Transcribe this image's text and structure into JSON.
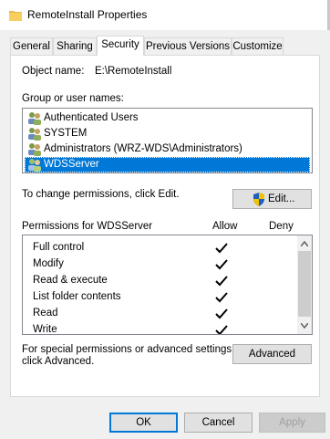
{
  "window": {
    "title": "RemoteInstall Properties"
  },
  "tabs": [
    {
      "label": "General"
    },
    {
      "label": "Sharing"
    },
    {
      "label": "Security"
    },
    {
      "label": "Previous Versions"
    },
    {
      "label": "Customize"
    }
  ],
  "object": {
    "label": "Object name:",
    "value": "E:\\RemoteInstall"
  },
  "groups": {
    "label": "Group or user names:",
    "items": [
      {
        "label": "Authenticated Users"
      },
      {
        "label": "SYSTEM"
      },
      {
        "label": "Administrators (WRZ-WDS\\Administrators)"
      },
      {
        "label": "WDSServer"
      }
    ]
  },
  "change_perm_text": "To change permissions, click Edit.",
  "edit_button": "Edit...",
  "permissions": {
    "header": "Permissions for WDSServer",
    "allow_label": "Allow",
    "deny_label": "Deny",
    "rows": [
      {
        "label": "Full control",
        "allow": true,
        "deny": false
      },
      {
        "label": "Modify",
        "allow": true,
        "deny": false
      },
      {
        "label": "Read & execute",
        "allow": true,
        "deny": false
      },
      {
        "label": "List folder contents",
        "allow": true,
        "deny": false
      },
      {
        "label": "Read",
        "allow": true,
        "deny": false
      },
      {
        "label": "Write",
        "allow": true,
        "deny": false
      }
    ]
  },
  "advanced_text_line1": "For special permissions or advanced settings,",
  "advanced_text_line2": "click Advanced.",
  "advanced_button": "Advanced",
  "footer": {
    "ok": "OK",
    "cancel": "Cancel",
    "apply": "Apply"
  }
}
